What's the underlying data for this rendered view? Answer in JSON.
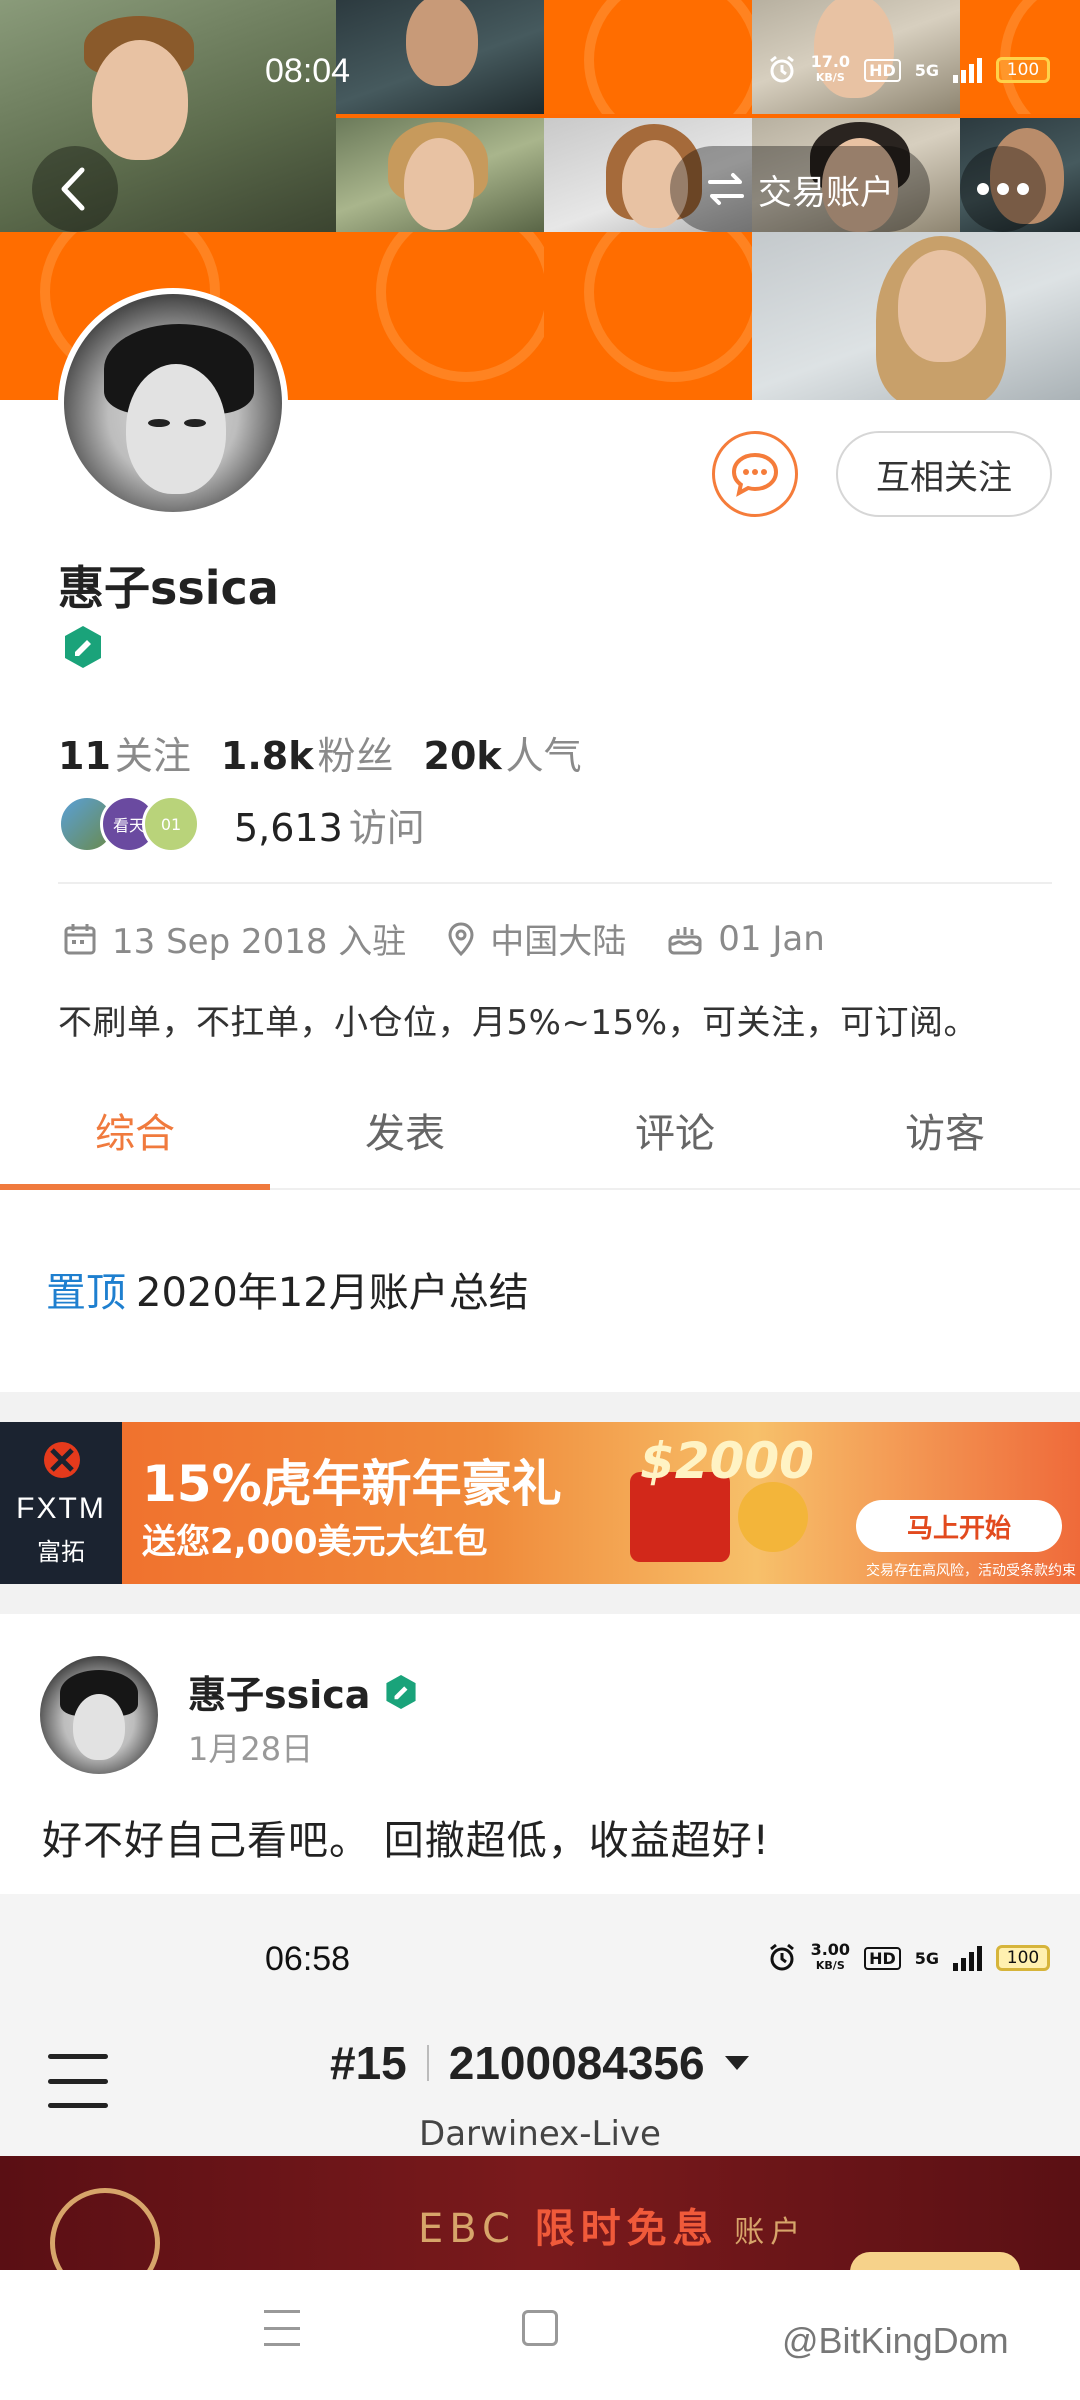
{
  "status_bar": {
    "time": "08:04",
    "speed_value": "17.0",
    "speed_unit": "KB/S",
    "hd": "HD",
    "network": "5G",
    "battery": "100"
  },
  "header": {
    "trade_account_label": "交易账户"
  },
  "profile": {
    "name": "惠子ssica",
    "follow_label": "互相关注",
    "stats": [
      {
        "value": "11",
        "label": "关注"
      },
      {
        "value": "1.8k",
        "label": "粉丝"
      },
      {
        "value": "20k",
        "label": "人气"
      }
    ],
    "visitor_avatars": [
      "",
      "看天",
      "01"
    ],
    "visits_value": "5,613",
    "visits_label": "访问",
    "joined": "13 Sep 2018 入驻",
    "location": "中国大陆",
    "birthday": "01 Jan",
    "bio": "不刷单，不扛单，小仓位，月5%~15%，可关注，可订阅。"
  },
  "tabs": [
    {
      "label": "综合",
      "active": true
    },
    {
      "label": "发表",
      "active": false
    },
    {
      "label": "评论",
      "active": false
    },
    {
      "label": "访客",
      "active": false
    }
  ],
  "pinned": {
    "tag": "置顶",
    "title": "2020年12月账户总结"
  },
  "ad": {
    "brand": "FXTM",
    "brand_cn": "富拓",
    "title": "15%虎年新年豪礼",
    "subtitle": "送您2,000美元大红包",
    "amount": "$2000",
    "cta": "马上开始",
    "disclaimer": "交易存在高风险，活动受条款约束"
  },
  "post": {
    "author": "惠子ssica",
    "date": "1月28日",
    "text": "好不好自己看吧。 回撤超低，收益超好!"
  },
  "embedded_screenshot": {
    "time": "06:58",
    "speed_value": "3.00",
    "speed_unit": "KB/S",
    "hd": "HD",
    "network": "5G",
    "battery": "100",
    "rank": "#15",
    "account_number": "2100084356",
    "server": "Darwinex-Live",
    "banner_prefix": "EBC ",
    "banner_highlight": "限时免息",
    "banner_suffix": " 账户"
  },
  "nav": {
    "watermark": "@BitKingDom"
  },
  "colors": {
    "accent": "#f07a3d",
    "pin_blue": "#1e7fcf",
    "cover_orange": "#ff6a00"
  }
}
